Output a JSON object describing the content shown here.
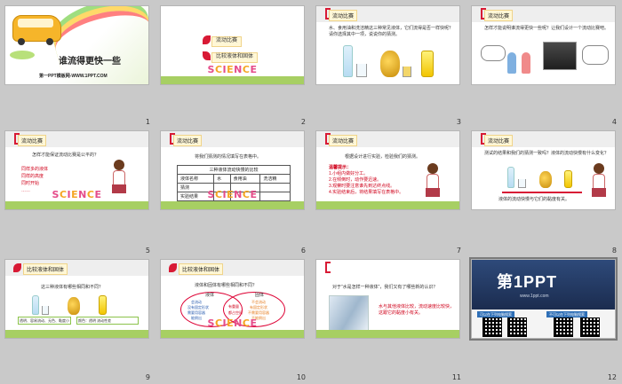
{
  "slides": [
    {
      "num": "1",
      "title": "谁流得更快一些",
      "subtitle": "第一PPT模板网-WWW.1PPT.COM"
    },
    {
      "num": "2",
      "items": [
        "流动比赛",
        "比较液体和固体"
      ]
    },
    {
      "num": "3",
      "header": "流动比赛",
      "text": "水、食用油和洗洁精这三种常见液体，它们流得是否一样快呢？请你选择其中一项，说说你的猜测。"
    },
    {
      "num": "4",
      "header": "流动比赛",
      "text": "怎样才能说明谁流得更快一些呢？让我们设计一个流动比赛吧。"
    },
    {
      "num": "5",
      "header": "流动比赛",
      "text": "怎样才能保证流动比赛是公平的？",
      "bullets": [
        "同样多的液体",
        "同样的高度",
        "同时开始",
        "……"
      ]
    },
    {
      "num": "6",
      "header": "流动比赛",
      "text": "将我们猜测的情况填写在表格中。",
      "table_title": "三种液体流动快慢的比较",
      "table_head": [
        "液体名称",
        "水",
        "食用油",
        "洗洁精"
      ],
      "table_rows": [
        "猜测",
        "实验结果"
      ]
    },
    {
      "num": "7",
      "header": "流动比赛",
      "text": "根据设计进行实验，检验我们的猜测。",
      "notes_title": "温馨提示：",
      "notes": [
        "1.小组内做好分工。",
        "2.在倾倒时，动作要迅速。",
        "3.观察时要注意谁先到达终点线。",
        "4.实验结束后，将结果填写在表格中。"
      ]
    },
    {
      "num": "8",
      "header": "流动比赛",
      "text": "测试的结果和我们的猜测一致吗？液体的流动快慢有什么变化？",
      "bottom": "液体的流动快慢与它们的黏度有关。"
    },
    {
      "num": "9",
      "header": "比较液体和固体",
      "text": "这三种液体有哪些相同和不同？",
      "desc1": "透明、容易流动、无色、黏度小",
      "desc2": "颜色：透明 流动性差"
    },
    {
      "num": "10",
      "header": "比较液体和固体",
      "text": "液体和固体有哪些相同和不同？",
      "left_label": "液体",
      "right_label": "固体",
      "left_items": [
        "会流动",
        "没有固定形状",
        "需要用容器",
        "能倒出"
      ],
      "mid_items": [
        "有重量",
        "都占空间"
      ],
      "right_items": [
        "不会流动",
        "有固定形状",
        "不需要用容器",
        "不能倒出"
      ]
    },
    {
      "num": "11",
      "header": "",
      "text": "对于“水是怎样一种液体”，我们又有了哪些新的认识？",
      "red_text": "水与其他液体比较，流动速度比较快，这跟它的黏度小有关。"
    },
    {
      "num": "12",
      "brand": "第1PPT",
      "brand_sub": "www.1ppt.com",
      "left_box": "可以在下列电脑搜索",
      "right_box": "不可以在下列电脑搜索"
    }
  ],
  "science_word": [
    "S",
    "C",
    "I",
    "E",
    "N",
    "C",
    "E"
  ],
  "colors": {
    "accent": "#d81a35",
    "grass": "#a7cf63",
    "header_bg": "#eeeeee"
  }
}
